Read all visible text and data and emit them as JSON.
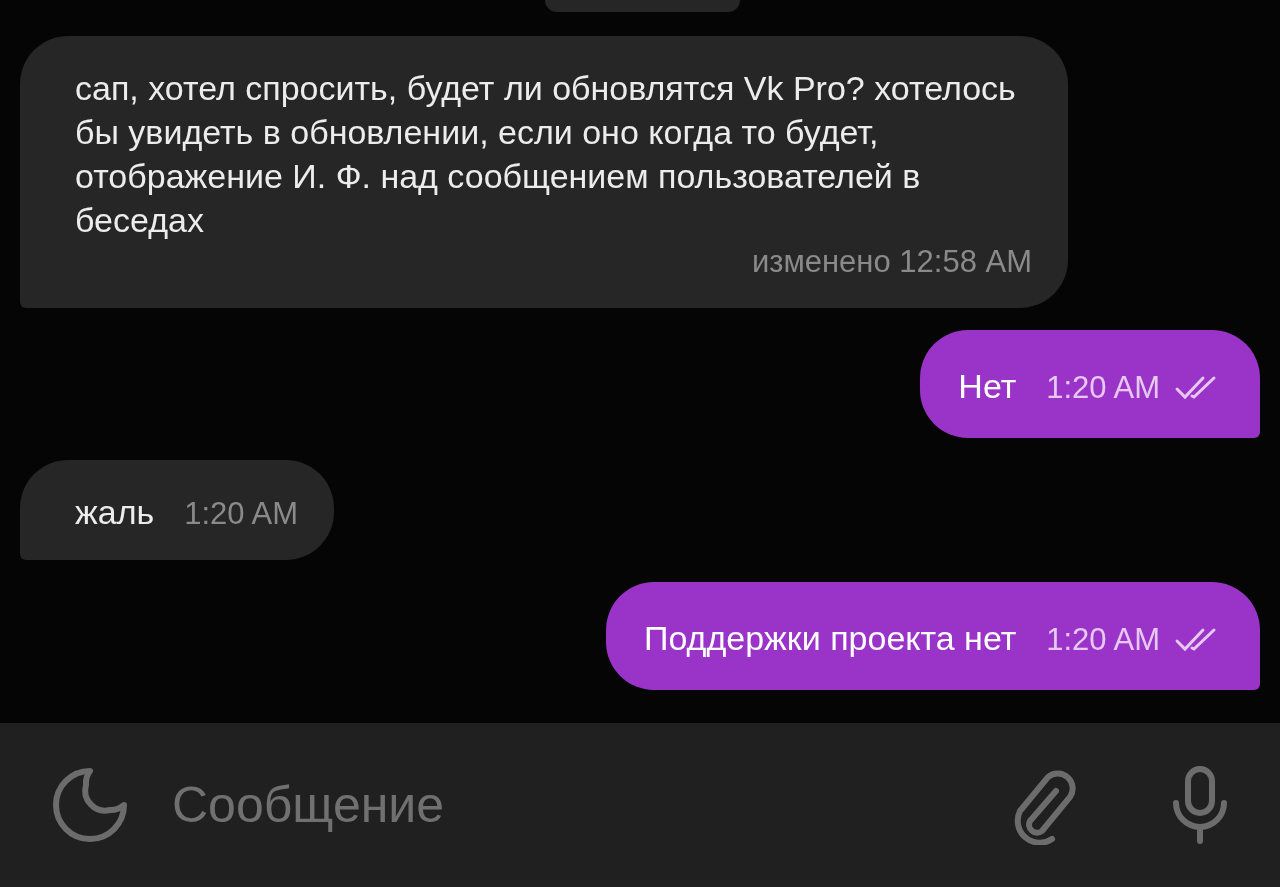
{
  "messages": [
    {
      "outgoing": false,
      "text": "сап, хотел спросить, будет ли обновлятся Vk Pro? хотелось бы увидеть в обновлении, если оно когда то будет, отображение И. Ф. над сообщением пользователей в беседах",
      "time": "изменено 12:58 AM"
    },
    {
      "outgoing": true,
      "text": "Нет",
      "time": "1:20 AM",
      "read": true
    },
    {
      "outgoing": false,
      "text": "жаль",
      "time": "1:20 AM"
    },
    {
      "outgoing": true,
      "text": "Поддержки проекта нет",
      "time": "1:20 AM",
      "read": true
    }
  ],
  "composer": {
    "placeholder": "Сообщение"
  }
}
